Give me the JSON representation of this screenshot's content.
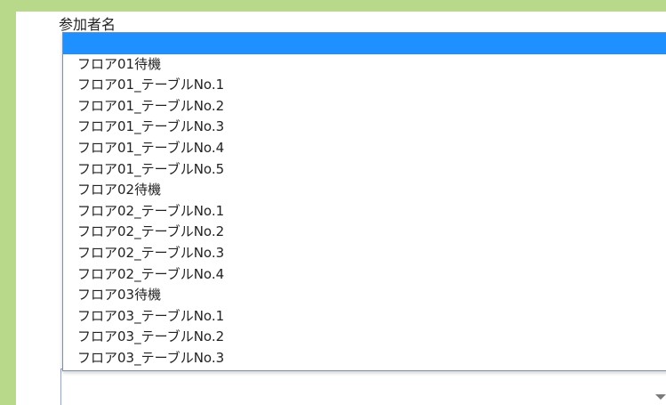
{
  "field": {
    "label": "参加者名"
  },
  "dropdown": {
    "selected_index": 0,
    "options": [
      "",
      "フロア01待機",
      "フロア01_テーブルNo.1",
      "フロア01_テーブルNo.2",
      "フロア01_テーブルNo.3",
      "フロア01_テーブルNo.4",
      "フロア01_テーブルNo.5",
      "フロア02待機",
      "フロア02_テーブルNo.1",
      "フロア02_テーブルNo.2",
      "フロア02_テーブルNo.3",
      "フロア02_テーブルNo.4",
      "フロア03待機",
      "フロア03_テーブルNo.1",
      "フロア03_テーブルNo.2",
      "フロア03_テーブルNo.3"
    ]
  },
  "select": {
    "value": ""
  },
  "colors": {
    "page_background": "#b9d98a",
    "selected_option_background": "#1e90ff"
  },
  "icons": {
    "select_arrow": "caret-down-icon"
  }
}
